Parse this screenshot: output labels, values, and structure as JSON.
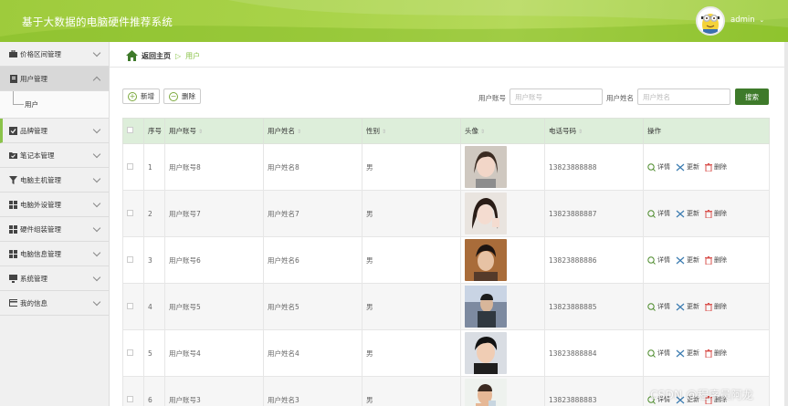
{
  "header": {
    "title": "基于大数据的电脑硬件推荐系统",
    "user": "admin",
    "caret": "⌄"
  },
  "sidebar": {
    "items": [
      {
        "label": "价格区间管理",
        "icon": "briefcase-icon"
      },
      {
        "label": "用户管理",
        "icon": "document-icon",
        "active": true
      },
      {
        "label": "品牌管理",
        "icon": "check-clipboard-icon"
      },
      {
        "label": "笔记本管理",
        "icon": "folder-check-icon"
      },
      {
        "label": "电脑主机管理",
        "icon": "funnel-icon"
      },
      {
        "label": "电脑外设管理",
        "icon": "grid-icon"
      },
      {
        "label": "硬件组装管理",
        "icon": "grid-icon"
      },
      {
        "label": "电脑信息管理",
        "icon": "grid-icon"
      },
      {
        "label": "系统管理",
        "icon": "monitor-icon"
      },
      {
        "label": "我的信息",
        "icon": "card-icon"
      }
    ],
    "submenu": {
      "label": "用户"
    }
  },
  "breadcrumb": {
    "home": "返回主页",
    "sep": "▷",
    "current": "用户"
  },
  "toolbar": {
    "add": "新增",
    "add_icon": "+",
    "delete": "删除",
    "delete_icon": "−"
  },
  "search": {
    "account_label": "用户账号",
    "account_placeholder": "用户账号",
    "name_label": "用户姓名",
    "name_placeholder": "用户姓名",
    "button": "搜索"
  },
  "table": {
    "headers": {
      "index": "序号",
      "account": "用户账号",
      "name": "用户姓名",
      "gender": "性别",
      "avatar": "头像",
      "phone": "电话号码",
      "ops": "操作"
    },
    "sort_glyph": "⇕",
    "op_labels": {
      "detail": "详情",
      "edit": "更新",
      "delete": "删除"
    },
    "rows": [
      {
        "index": "1",
        "account": "用户账号8",
        "name": "用户姓名8",
        "gender": "男",
        "phone": "13823888888"
      },
      {
        "index": "2",
        "account": "用户账号7",
        "name": "用户姓名7",
        "gender": "男",
        "phone": "13823888887"
      },
      {
        "index": "3",
        "account": "用户账号6",
        "name": "用户姓名6",
        "gender": "男",
        "phone": "13823888886"
      },
      {
        "index": "4",
        "account": "用户账号5",
        "name": "用户姓名5",
        "gender": "男",
        "phone": "13823888885"
      },
      {
        "index": "5",
        "account": "用户账号4",
        "name": "用户姓名4",
        "gender": "男",
        "phone": "13823888884"
      },
      {
        "index": "6",
        "account": "用户账号3",
        "name": "用户姓名3",
        "gender": "男",
        "phone": "13823888883"
      }
    ]
  },
  "watermark": "CSDN @程序员阿龙",
  "colors": {
    "accent": "#8bc34a",
    "header": "#a6d145",
    "search_button": "#3e7a2a"
  }
}
